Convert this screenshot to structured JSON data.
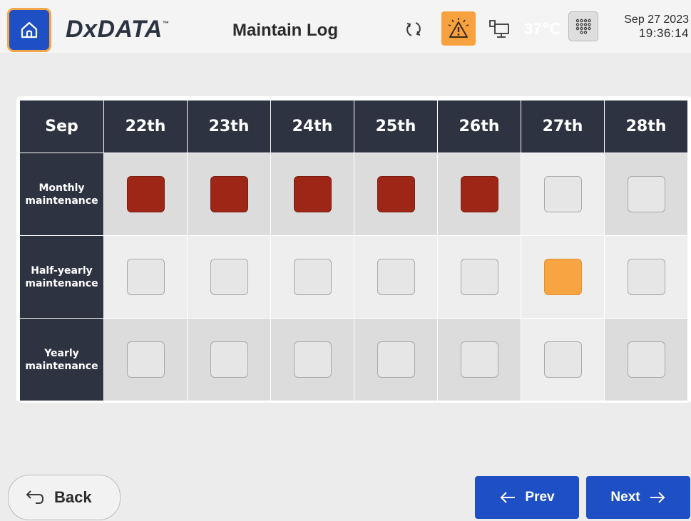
{
  "header": {
    "brand": "DxDATA",
    "brand_tm": "™",
    "title": "Maintain Log",
    "temperature": "37℃",
    "date": "Sep 27 2023",
    "time": "19:36:14"
  },
  "icons": [
    "home-icon",
    "sync-icon",
    "alarm-icon",
    "network-icon",
    "keypad-icon",
    "undo-arrow-icon",
    "arrow-left-icon",
    "arrow-right-icon"
  ],
  "colors": {
    "accent_blue": "#1f4fc4",
    "header_dark": "#2d3340",
    "done_red": "#9d2617",
    "due_orange": "#f7a443"
  },
  "table": {
    "month": "Sep",
    "days": [
      "22th",
      "23th",
      "24th",
      "25th",
      "26th",
      "27th",
      "28th"
    ],
    "rows": [
      {
        "label": "Monthly maintenance",
        "status": [
          "done",
          "done",
          "done",
          "done",
          "done",
          "empty",
          "empty"
        ]
      },
      {
        "label": "Half-yearly maintenance",
        "status": [
          "empty",
          "empty",
          "empty",
          "empty",
          "empty",
          "due",
          "empty"
        ]
      },
      {
        "label": "Yearly maintenance",
        "status": [
          "empty",
          "empty",
          "empty",
          "empty",
          "empty",
          "empty",
          "empty"
        ]
      }
    ]
  },
  "footer": {
    "back_label": "Back",
    "prev_label": "Prev",
    "next_label": "Next"
  }
}
